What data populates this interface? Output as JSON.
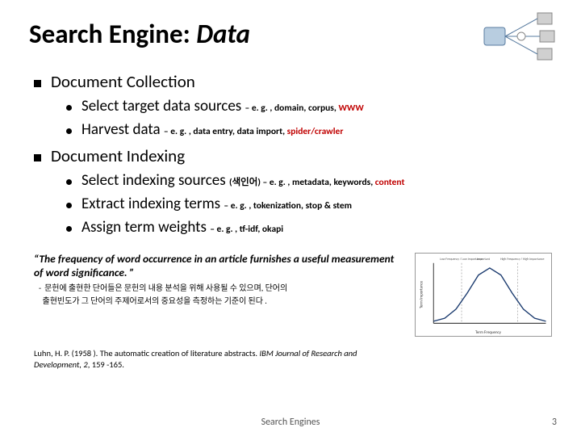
{
  "title": {
    "main": "Search Engine: ",
    "emph": "Data"
  },
  "sections": [
    {
      "heading": "Document Collection",
      "items": [
        {
          "label": "Select target data sources ",
          "sub_prefix": "– e. g. , domain, corpus, ",
          "sub_red": "WWW"
        },
        {
          "label": "Harvest data ",
          "sub_prefix": "– e. g. , data entry, data import, ",
          "sub_red": "spider/crawler"
        }
      ]
    },
    {
      "heading": "Document Indexing",
      "items": [
        {
          "label": "Select indexing sources ",
          "sub_prefix": "(색인어) – e. g. , metadata, keywords, ",
          "sub_red": "content"
        },
        {
          "label": "Extract indexing terms ",
          "sub_prefix": "– e. g. , tokenization, stop & stem",
          "sub_red": ""
        },
        {
          "label": "Assign term weights ",
          "sub_prefix": "– e. g. , tf-idf, okapi",
          "sub_red": ""
        }
      ]
    }
  ],
  "quote": "“The frequency of word occurrence in an article furnishes a useful  measurement of word significance. ”",
  "ko_note_1": "문헌에 출현한 단어들은 문헌의 내용 분석을 위해 사용될 수 있으며, 단어의",
  "ko_note_2": "출현빈도가 그 단어의 주제어로서의 중요성을 측정하는 기준이 된다 .",
  "citation_plain": "Luhn, H. P. (1958 ). The automatic creation of literature abstracts. ",
  "citation_ital": "IBM Journal of Research and Development, 2",
  "citation_tail": ", 159 -165.",
  "chart_data": {
    "type": "line",
    "title": "",
    "xlabel": "Term Frequency",
    "ylabel": "Term Importance",
    "annotations": [
      "Low Frequency / Low Importance",
      "Important",
      "High Frequency / High Importance"
    ],
    "x": [
      0,
      1,
      2,
      3,
      4,
      5,
      6,
      7,
      8,
      9,
      10
    ],
    "values": [
      2,
      5,
      14,
      30,
      48,
      55,
      48,
      30,
      14,
      5,
      2
    ],
    "cutoffs": {
      "lower_x": 2.5,
      "upper_x": 7.5
    },
    "ylim": [
      0,
      60
    ]
  },
  "footer": "Search Engines",
  "page": "3"
}
